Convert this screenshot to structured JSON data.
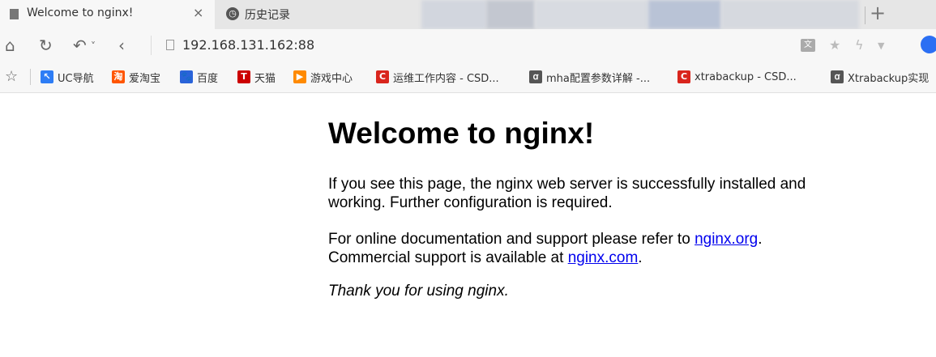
{
  "tabs": {
    "active_title": "Welcome to nginx!",
    "close_glyph": "×",
    "second_title": "历史记录",
    "new_tab_glyph": "+"
  },
  "toolbar": {
    "url": "192.168.131.162:88"
  },
  "bookmarks": [
    {
      "label": "UC导航",
      "icon": "uc-nav-icon",
      "color": "#2e7df5",
      "glyph": "↖"
    },
    {
      "label": "爱淘宝",
      "icon": "taobao-icon",
      "color": "#ff5500",
      "glyph": "淘"
    },
    {
      "label": "百度",
      "icon": "baidu-paw-icon",
      "color": "#2a63d9",
      "glyph": "🐾"
    },
    {
      "label": "天猫",
      "icon": "tmall-icon",
      "color": "#cc0000",
      "glyph": "T"
    },
    {
      "label": "游戏中心",
      "icon": "game-center-icon",
      "color": "#ff8a00",
      "glyph": "▶"
    },
    {
      "label": "运维工作内容 - CSD...",
      "icon": "csdn-icon",
      "color": "#d9251d",
      "glyph": "C"
    },
    {
      "label": "mha配置参数详解 -...",
      "icon": "signature-icon",
      "color": "#555555",
      "glyph": "ꭤ"
    },
    {
      "label": "xtrabackup - CSD...",
      "icon": "csdn-icon",
      "color": "#d9251d",
      "glyph": "C"
    },
    {
      "label": "Xtrabackup实现",
      "icon": "signature-icon",
      "color": "#555555",
      "glyph": "ꭤ"
    }
  ],
  "page": {
    "heading": "Welcome to nginx!",
    "para1": "If you see this page, the nginx web server is successfully installed and working. Further configuration is required.",
    "para2_prefix": "For online documentation and support please refer to ",
    "link1": "nginx.org",
    "para2_mid": ".",
    "para2_line2": "Commercial support is available at ",
    "link2": "nginx.com",
    "para2_end": ".",
    "thanks": "Thank you for using nginx."
  }
}
